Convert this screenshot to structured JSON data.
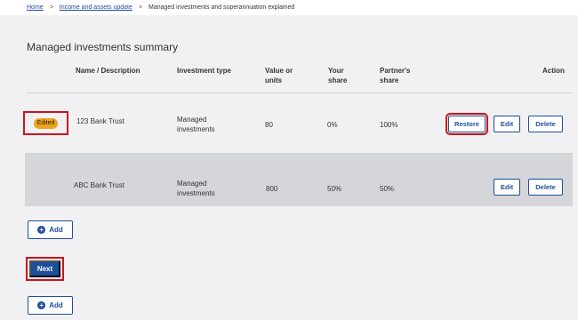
{
  "breadcrumb": {
    "home": "Home",
    "separator": ">",
    "income": "Income and assets update",
    "current": "Managed investments and superannuation explained"
  },
  "page": {
    "title": "Managed investments summary"
  },
  "table": {
    "headers": {
      "name": "Name / Description",
      "type": "Investment type",
      "value_line1": "Value or",
      "value_line2": "units",
      "share_line1": "Your",
      "share_line2": "share",
      "partner_line1": "Partner's",
      "partner_line2": "share",
      "action": "Action"
    },
    "rows": [
      {
        "badge": "Edited",
        "name": "123 Bank Trust",
        "type_line1": "Managed",
        "type_line2": "investments",
        "value": "80",
        "your_share": "0%",
        "partner_share": "100%",
        "restore": "Restore",
        "edit": "Edit",
        "delete": "Delete"
      },
      {
        "name": "ABC Bank Trust",
        "type_line1": "Managed",
        "type_line2": "investments",
        "value": "800",
        "your_share": "50%",
        "partner_share": "50%",
        "edit": "Edit",
        "delete": "Delete"
      }
    ]
  },
  "buttons": {
    "add": "Add",
    "next": "Next",
    "add_plus": "+"
  },
  "colors": {
    "primary": "#1d4e9a",
    "highlight_frame": "#d3101a",
    "badge": "#f0a41a",
    "row_disabled": "#d5d6d9",
    "background": "#f1f1f3"
  }
}
